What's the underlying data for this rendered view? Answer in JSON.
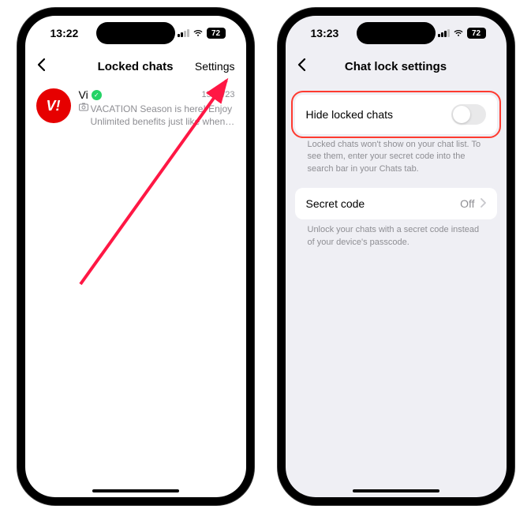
{
  "left": {
    "status": {
      "time": "13:22",
      "battery": "72"
    },
    "nav": {
      "title": "Locked chats",
      "settings": "Settings"
    },
    "chat": {
      "avatar_text": "V!",
      "name": "Vi",
      "date": "15/11/23",
      "preview": "VACATION Season is here! Enjoy Unlimited benefits just like when you are in India even..."
    }
  },
  "right": {
    "status": {
      "time": "13:23",
      "battery": "72"
    },
    "nav": {
      "title": "Chat lock settings"
    },
    "hide": {
      "label": "Hide locked chats",
      "hint": "Locked chats won't show on your chat list. To see them, enter your secret code into the search bar in your Chats tab."
    },
    "secret": {
      "label": "Secret code",
      "value": "Off",
      "hint": "Unlock your chats with a secret code instead of your device's passcode."
    }
  }
}
